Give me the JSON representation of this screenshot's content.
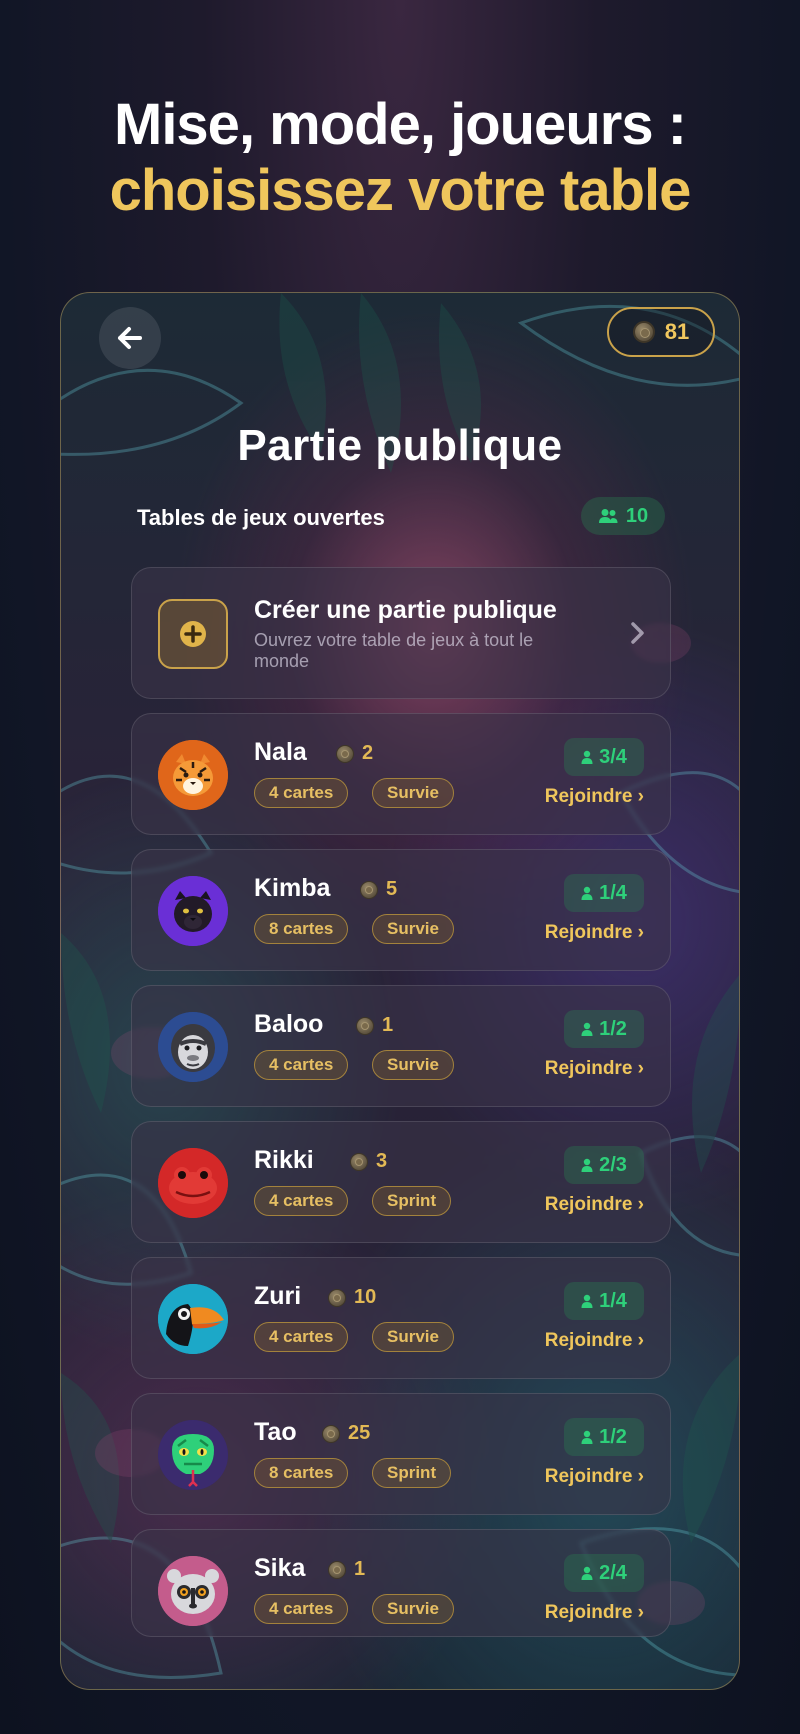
{
  "headline": {
    "line1": "Mise, mode, joueurs :",
    "line2": "choisissez votre table"
  },
  "topbar": {
    "back_icon": "arrow-left-icon",
    "coins": "81"
  },
  "title": "Partie publique",
  "section": {
    "label": "Tables de jeux ouvertes",
    "open_count": "10"
  },
  "create": {
    "title": "Créer une partie publique",
    "subtitle": "Ouvrez votre table de jeux à tout le monde"
  },
  "tables": [
    {
      "name": "Nala",
      "bet": "2",
      "cards": "4 cartes",
      "mode": "Survie",
      "players": "3/4",
      "join": "Rejoindre ›",
      "avatar": "tiger-icon"
    },
    {
      "name": "Kimba",
      "bet": "5",
      "cards": "8 cartes",
      "mode": "Survie",
      "players": "1/4",
      "join": "Rejoindre ›",
      "avatar": "panther-icon"
    },
    {
      "name": "Baloo",
      "bet": "1",
      "cards": "4 cartes",
      "mode": "Survie",
      "players": "1/2",
      "join": "Rejoindre ›",
      "avatar": "gorilla-icon"
    },
    {
      "name": "Rikki",
      "bet": "3",
      "cards": "4 cartes",
      "mode": "Sprint",
      "players": "2/3",
      "join": "Rejoindre ›",
      "avatar": "frog-icon"
    },
    {
      "name": "Zuri",
      "bet": "10",
      "cards": "4 cartes",
      "mode": "Survie",
      "players": "1/4",
      "join": "Rejoindre ›",
      "avatar": "toucan-icon"
    },
    {
      "name": "Tao",
      "bet": "25",
      "cards": "8 cartes",
      "mode": "Sprint",
      "players": "1/2",
      "join": "Rejoindre ›",
      "avatar": "snake-icon"
    },
    {
      "name": "Sika",
      "bet": "1",
      "cards": "4 cartes",
      "mode": "Survie",
      "players": "2/4",
      "join": "Rejoindre ›",
      "avatar": "lemur-icon"
    }
  ],
  "colors": {
    "accent_gold": "#efc65c",
    "player_green": "#2ed07a",
    "card_bg": "#3a3448"
  }
}
